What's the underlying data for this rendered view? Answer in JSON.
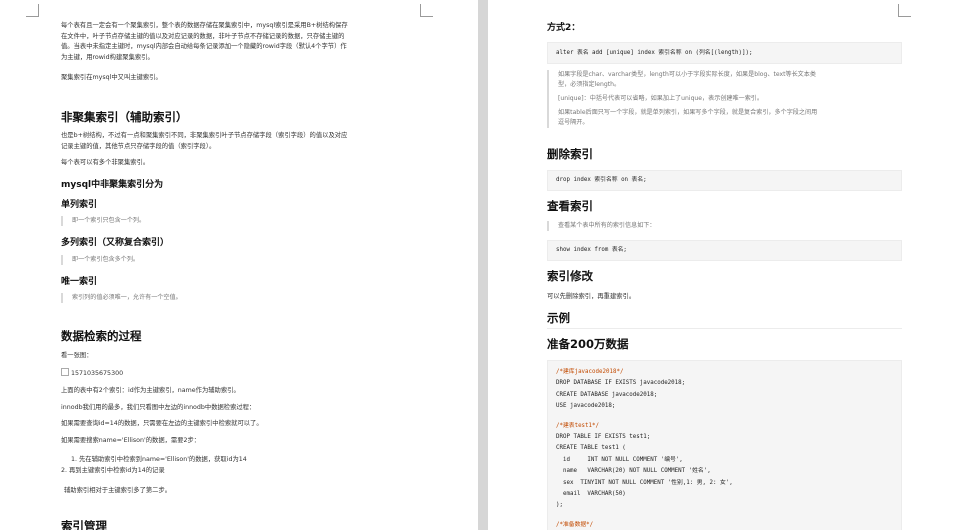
{
  "left": {
    "intro_lines": [
      "每个表有且一定会有一个聚集索引，整个表的数据存储在聚集索引中，mysql索引是采用B+树结构保存",
      "在文件中，叶子节点存储主键的值以及对应记录的数据，非叶子节点不存储记录的数据，只存储主键的",
      "值。当表中未指定主键时，mysql内部会自动给每条记录添加一个隐藏的rowid字段（默认4个字节）作",
      "为主键，用rowid构建聚集索引。"
    ],
    "intro_note": "聚集索引在mysql中又叫主键索引。",
    "nonclustered_heading": "非聚集索引（辅助索引）",
    "nonclustered_lines": [
      "也是b+树结构，不过有一点和聚集索引不同，非聚集索引叶子节点存储字段（索引字段）的值以及对应",
      "记录主键的值，其他节点只存储字段的值（索引字段）。"
    ],
    "each_table_note": "每个表可以有多个非聚集索引。",
    "classify_heading": "mysql中非聚集索引分为",
    "single_heading": "单列索引",
    "single_quote": "即一个索引只包含一个列。",
    "multi_heading": "多列索引（又称复合索引）",
    "multi_quote": "即一个索引包含多个列。",
    "unique_heading": "唯一索引",
    "unique_quote": "索引列的值必须唯一，允许有一个空值。",
    "process_heading": "数据检索的过程",
    "see_image": "看一张图：",
    "image_alt": "1571035675300",
    "process_lines": [
      "上面的表中有2个索引：id作为主键索引，name作为辅助索引。",
      "innodb我们用的最多，我们只看图中左边的innodb中数据检索过程：",
      "如果需要查询id=14的数据，只需要在左边的主键索引中检索就可以了。",
      "如果需要搜索name='Ellison'的数据，需要2步："
    ],
    "steps": [
      "1. 先在辅助索引中检索到name='Ellison'的数据，获取id为14",
      "2.      再到主键索引中检索id为14的记录"
    ],
    "step_note": "辅助索引相对于主键索引多了第二步。",
    "index_mgmt_heading": "索引管理"
  },
  "right": {
    "method2_heading": "方式2：",
    "method2_code": "alter 表名 add [unique] index 索引名称 on (列名[(length)]);",
    "method2_quotes": [
      "如果字段是char、varchar类型，length可以小于字段实际长度，如果是blog、text等长文本类",
      "型，必须指定length。",
      "[unique]：中括号代表可以省略，如果加上了unique，表示创建唯一索引。",
      "如果table后面只写一个字段，就是单列索引，如果写多个字段，就是复合索引，多个字段之间用",
      "逗号隔开。"
    ],
    "drop_heading": "删除索引",
    "drop_code": "drop index 索引名称 on 表名;",
    "show_heading": "查看索引",
    "show_quote": "查看某个表中所有的索引信息如下：",
    "show_code": "show index from 表名;",
    "modify_heading": "索引修改",
    "modify_text": "可以先删除索引，再重建索引。",
    "example_heading": "示例",
    "prepare_heading": "准备200万数据",
    "sql_comment_1": "/*建库javacode2018*/",
    "sql_l2": "DROP DATABASE IF EXISTS javacode2018;",
    "sql_l3": "CREATE DATABASE javacode2018;",
    "sql_l4": "USE javacode2018;",
    "sql_comment_2": "/*建表test1*/",
    "sql_l6": "DROP TABLE IF EXISTS test1;",
    "sql_l7": "CREATE TABLE test1 (",
    "sql_l8": "  id     INT NOT NULL COMMENT '编号',",
    "sql_l9": "  name   VARCHAR(20) NOT NULL COMMENT '姓名',",
    "sql_l10": "  sex  TINYINT NOT NULL COMMENT '性别,1: 男, 2: 女',",
    "sql_l11": "  email  VARCHAR(50)",
    "sql_l12": ");",
    "sql_comment_3": "/*准备数据*/"
  }
}
